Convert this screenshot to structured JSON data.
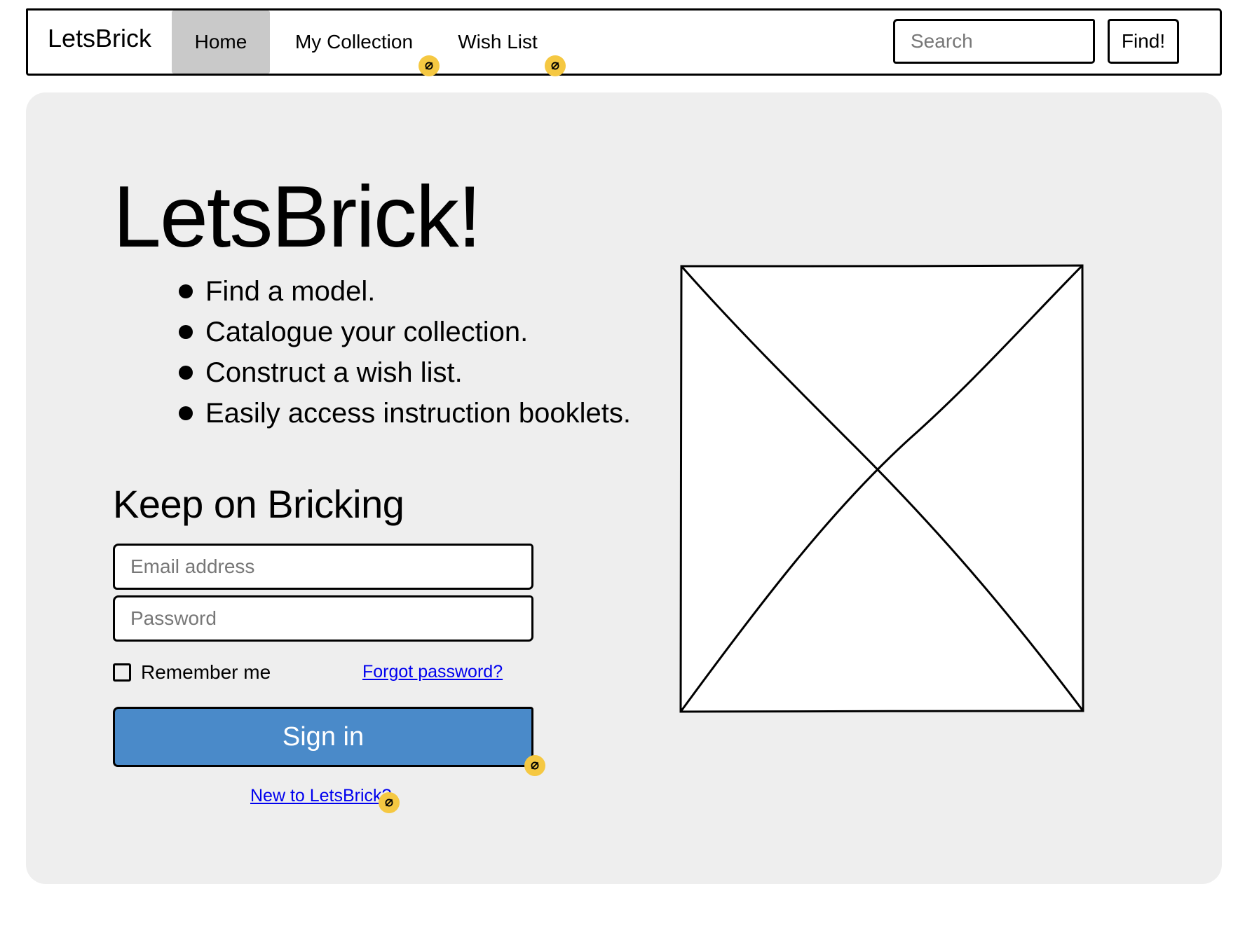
{
  "navbar": {
    "brand": "LetsBrick",
    "items": [
      {
        "label": "Home",
        "active": true
      },
      {
        "label": "My Collection",
        "active": false
      },
      {
        "label": "Wish List",
        "active": false
      }
    ],
    "search_placeholder": "Search",
    "find_label": "Find!"
  },
  "hero": {
    "title": "LetsBrick!",
    "features": [
      "Find a model.",
      "Catalogue your collection.",
      "Construct a wish list.",
      "Easily access instruction booklets."
    ]
  },
  "login": {
    "title": "Keep on Bricking",
    "email_placeholder": "Email address",
    "password_placeholder": "Password",
    "remember_label": "Remember me",
    "forgot_label": "Forgot password?",
    "signin_label": "Sign in",
    "new_label": "New to LetsBrick?"
  },
  "colors": {
    "panel_bg": "#eeeeee",
    "active_nav_bg": "#c9c9c9",
    "primary_button": "#4a8ac9",
    "link": "#0000ee",
    "link_badge": "#f5c842"
  },
  "icons": {
    "link_badge": "link-icon",
    "image": "image-placeholder-icon"
  }
}
